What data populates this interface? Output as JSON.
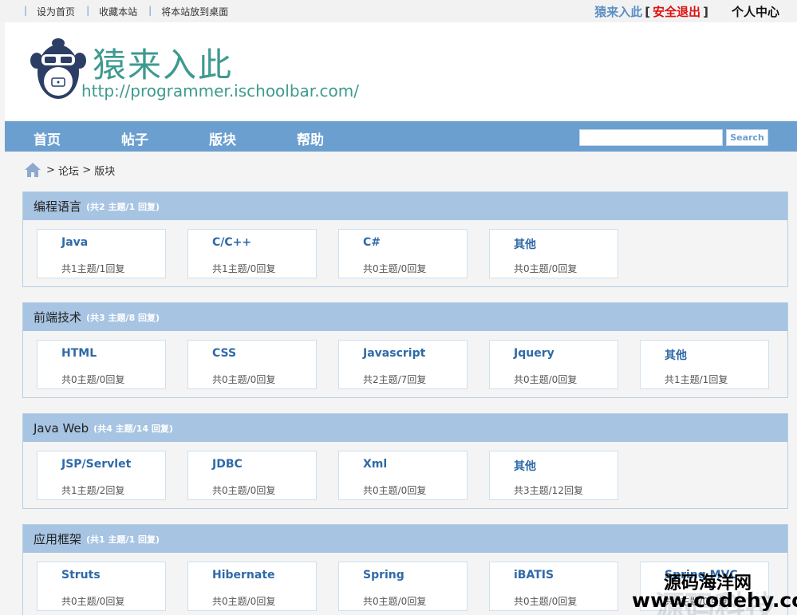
{
  "topbar": {
    "links": [
      "设为首页",
      "收藏本站",
      "将本站放到桌面"
    ],
    "username": "猿来入此",
    "bracket_open": "[",
    "logout": "安全退出",
    "bracket_close": "]",
    "user_center": "个人中心"
  },
  "header": {
    "title": "猿来入此",
    "url": "http://programmer.ischoolbar.com/"
  },
  "nav": {
    "items": [
      "首页",
      "帖子",
      "版块",
      "帮助"
    ],
    "search_button": "Search",
    "search_value": ""
  },
  "breadcrumb": {
    "separator": ">",
    "items": [
      "论坛",
      "版块"
    ]
  },
  "sections": [
    {
      "title": "编程语言",
      "stats_prefix": "(共",
      "topics": "2",
      "stats_mid": " 主题/",
      "replies": "1",
      "stats_suffix": " 回复)",
      "boards": [
        {
          "name": "Java",
          "count": "共1主题/1回复"
        },
        {
          "name": "C/C++",
          "count": "共1主题/0回复"
        },
        {
          "name": "C#",
          "count": "共0主题/0回复"
        },
        {
          "name": "其他",
          "count": "共0主题/0回复"
        }
      ]
    },
    {
      "title": "前端技术",
      "stats_prefix": "(共",
      "topics": "3",
      "stats_mid": " 主题/",
      "replies": "8",
      "stats_suffix": " 回复)",
      "boards": [
        {
          "name": "HTML",
          "count": "共0主题/0回复"
        },
        {
          "name": "CSS",
          "count": "共0主题/0回复"
        },
        {
          "name": "Javascript",
          "count": "共2主题/7回复"
        },
        {
          "name": "Jquery",
          "count": "共0主题/0回复"
        },
        {
          "name": "其他",
          "count": "共1主题/1回复"
        }
      ]
    },
    {
      "title": "Java Web",
      "stats_prefix": "(共",
      "topics": "4",
      "stats_mid": " 主题/",
      "replies": "14",
      "stats_suffix": " 回复)",
      "boards": [
        {
          "name": "JSP/Servlet",
          "count": "共1主题/2回复"
        },
        {
          "name": "JDBC",
          "count": "共0主题/0回复"
        },
        {
          "name": "Xml",
          "count": "共0主题/0回复"
        },
        {
          "name": "其他",
          "count": "共3主题/12回复"
        }
      ]
    },
    {
      "title": "应用框架",
      "stats_prefix": "(共",
      "topics": "1",
      "stats_mid": " 主题/",
      "replies": "1",
      "stats_suffix": " 回复)",
      "boards": [
        {
          "name": "Struts",
          "count": "共0主题/0回复"
        },
        {
          "name": "Hibernate",
          "count": "共0主题/0回复"
        },
        {
          "name": "Spring",
          "count": "共0主题/0回复"
        },
        {
          "name": "iBATIS",
          "count": "共0主题/0回复"
        },
        {
          "name": "Spring MVC",
          "count": "共0主题/0回复"
        }
      ]
    }
  ],
  "watermark": {
    "title": "源码海洋网",
    "url": "www.codehy.com",
    "ghost": "源码科技"
  }
}
